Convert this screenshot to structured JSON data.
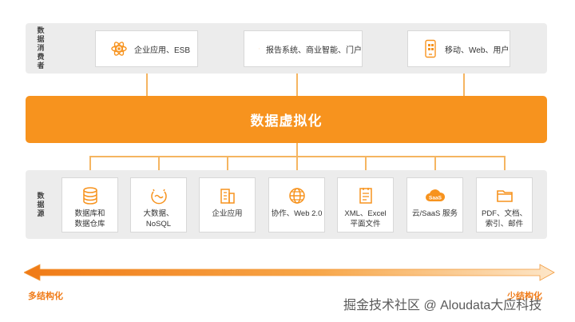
{
  "consumers": {
    "label": [
      "数",
      "据",
      "消",
      "费",
      "者"
    ],
    "items": [
      {
        "icon": "atom-icon",
        "label": "企业应用、ESB"
      },
      {
        "icon": "report-icon",
        "label": "报告系统、商业智能、门户"
      },
      {
        "icon": "mobile-icon",
        "label": "移动、Web、用户"
      }
    ]
  },
  "virtualization": {
    "title": "数据虚拟化"
  },
  "sources": {
    "label": [
      "数",
      "据",
      "源"
    ],
    "items": [
      {
        "icon": "database-icon",
        "label": "数据库和\n数据仓库"
      },
      {
        "icon": "big-data-icon",
        "label": "大数据、\nNoSQL"
      },
      {
        "icon": "building-icon",
        "label": "企业应用"
      },
      {
        "icon": "globe-icon",
        "label": "协作、Web 2.0"
      },
      {
        "icon": "xml-document-icon",
        "label": "XML、Excel\n平面文件"
      },
      {
        "icon": "saas-cloud-icon",
        "label": "云/SaaS 服务",
        "badge": "SaaS"
      },
      {
        "icon": "folder-icon",
        "label": "PDF、文档、\n索引、邮件"
      }
    ]
  },
  "axis": {
    "left": "多结构化",
    "right": "少结构化"
  },
  "watermark": "掘金技术社区 @ Aloudata大应科技",
  "colors": {
    "accent": "#f7931e",
    "band": "#ececec",
    "connector": "#f5b561"
  }
}
